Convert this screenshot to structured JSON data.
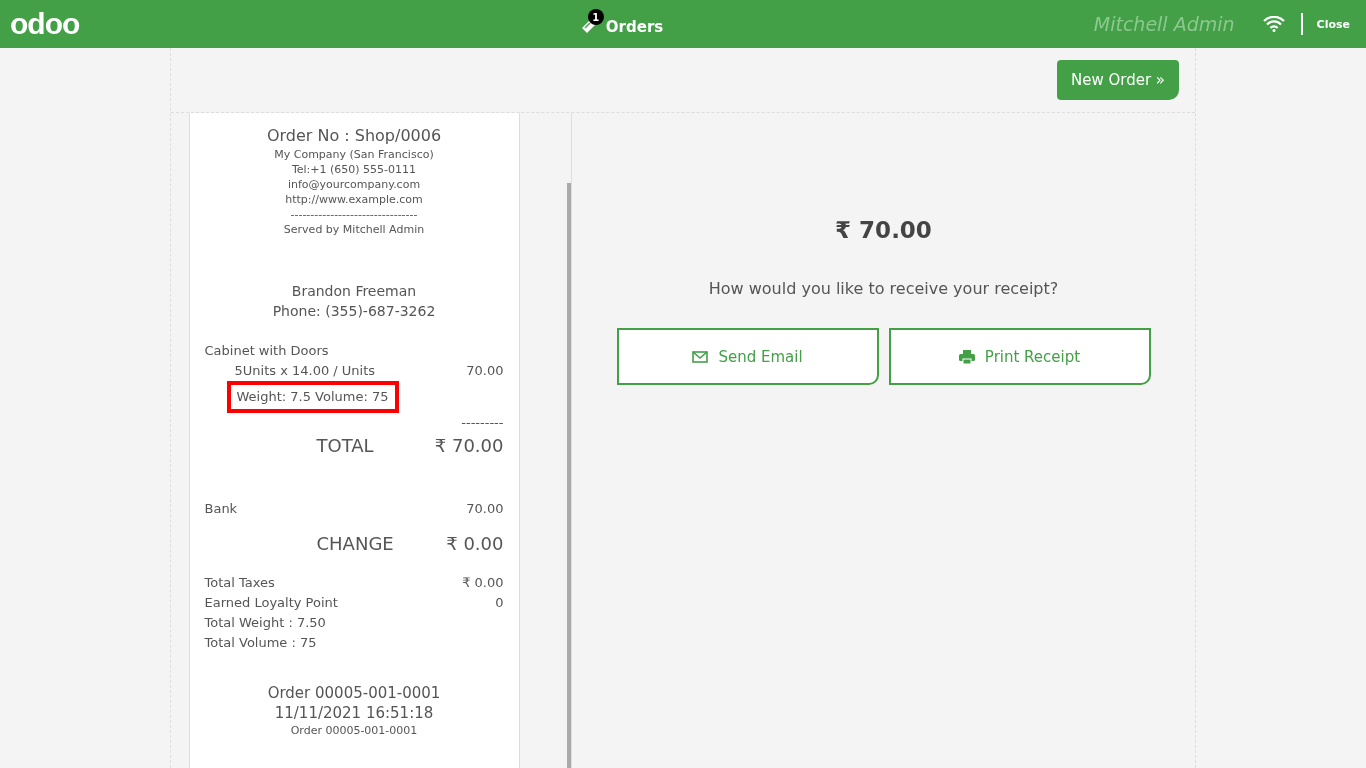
{
  "header": {
    "logo": "odoo",
    "orders_count": "1",
    "orders_label": "Orders",
    "user": "Mitchell Admin",
    "close": "Close"
  },
  "new_order": "New Order »",
  "receipt": {
    "order_no": "Order No : Shop/0006",
    "company_lines": [
      "My Company (San Francisco)",
      "Tel:+1 (650) 555-0111",
      "info@yourcompany.com",
      "http://www.example.com"
    ],
    "separator": "--------------------------------",
    "served_by": "Served by Mitchell Admin",
    "customer": [
      "Brandon Freeman",
      "Phone: (355)-687-3262"
    ],
    "product": {
      "name": "Cabinet with Doors",
      "qty_line": "5Units x 14.00 / Units",
      "price": "70.00",
      "extra": "Weight: 7.5 Volume: 75",
      "highlighted": true
    },
    "total_separator": "---------",
    "total": {
      "label": "TOTAL",
      "value": "₹ 70.00"
    },
    "payments": [
      {
        "label": "Bank",
        "value": "70.00"
      }
    ],
    "change": {
      "label": "CHANGE",
      "value": "₹ 0.00"
    },
    "summary": [
      {
        "label": "Total Taxes",
        "value": "₹ 0.00"
      },
      {
        "label": "Earned Loyalty Point",
        "value": "0"
      },
      {
        "label": "Total Weight : 7.50"
      },
      {
        "label": "Total Volume : 75"
      }
    ],
    "footer": [
      "Order 00005-001-0001",
      "11/11/2021 16:51:18"
    ],
    "footer_small": "Order 00005-001-0001"
  },
  "amount": "₹ 70.00",
  "question": "How would you like to receive your receipt?",
  "actions": [
    {
      "kind": "email",
      "label": "Send Email"
    },
    {
      "kind": "print",
      "label": "Print Receipt"
    }
  ]
}
